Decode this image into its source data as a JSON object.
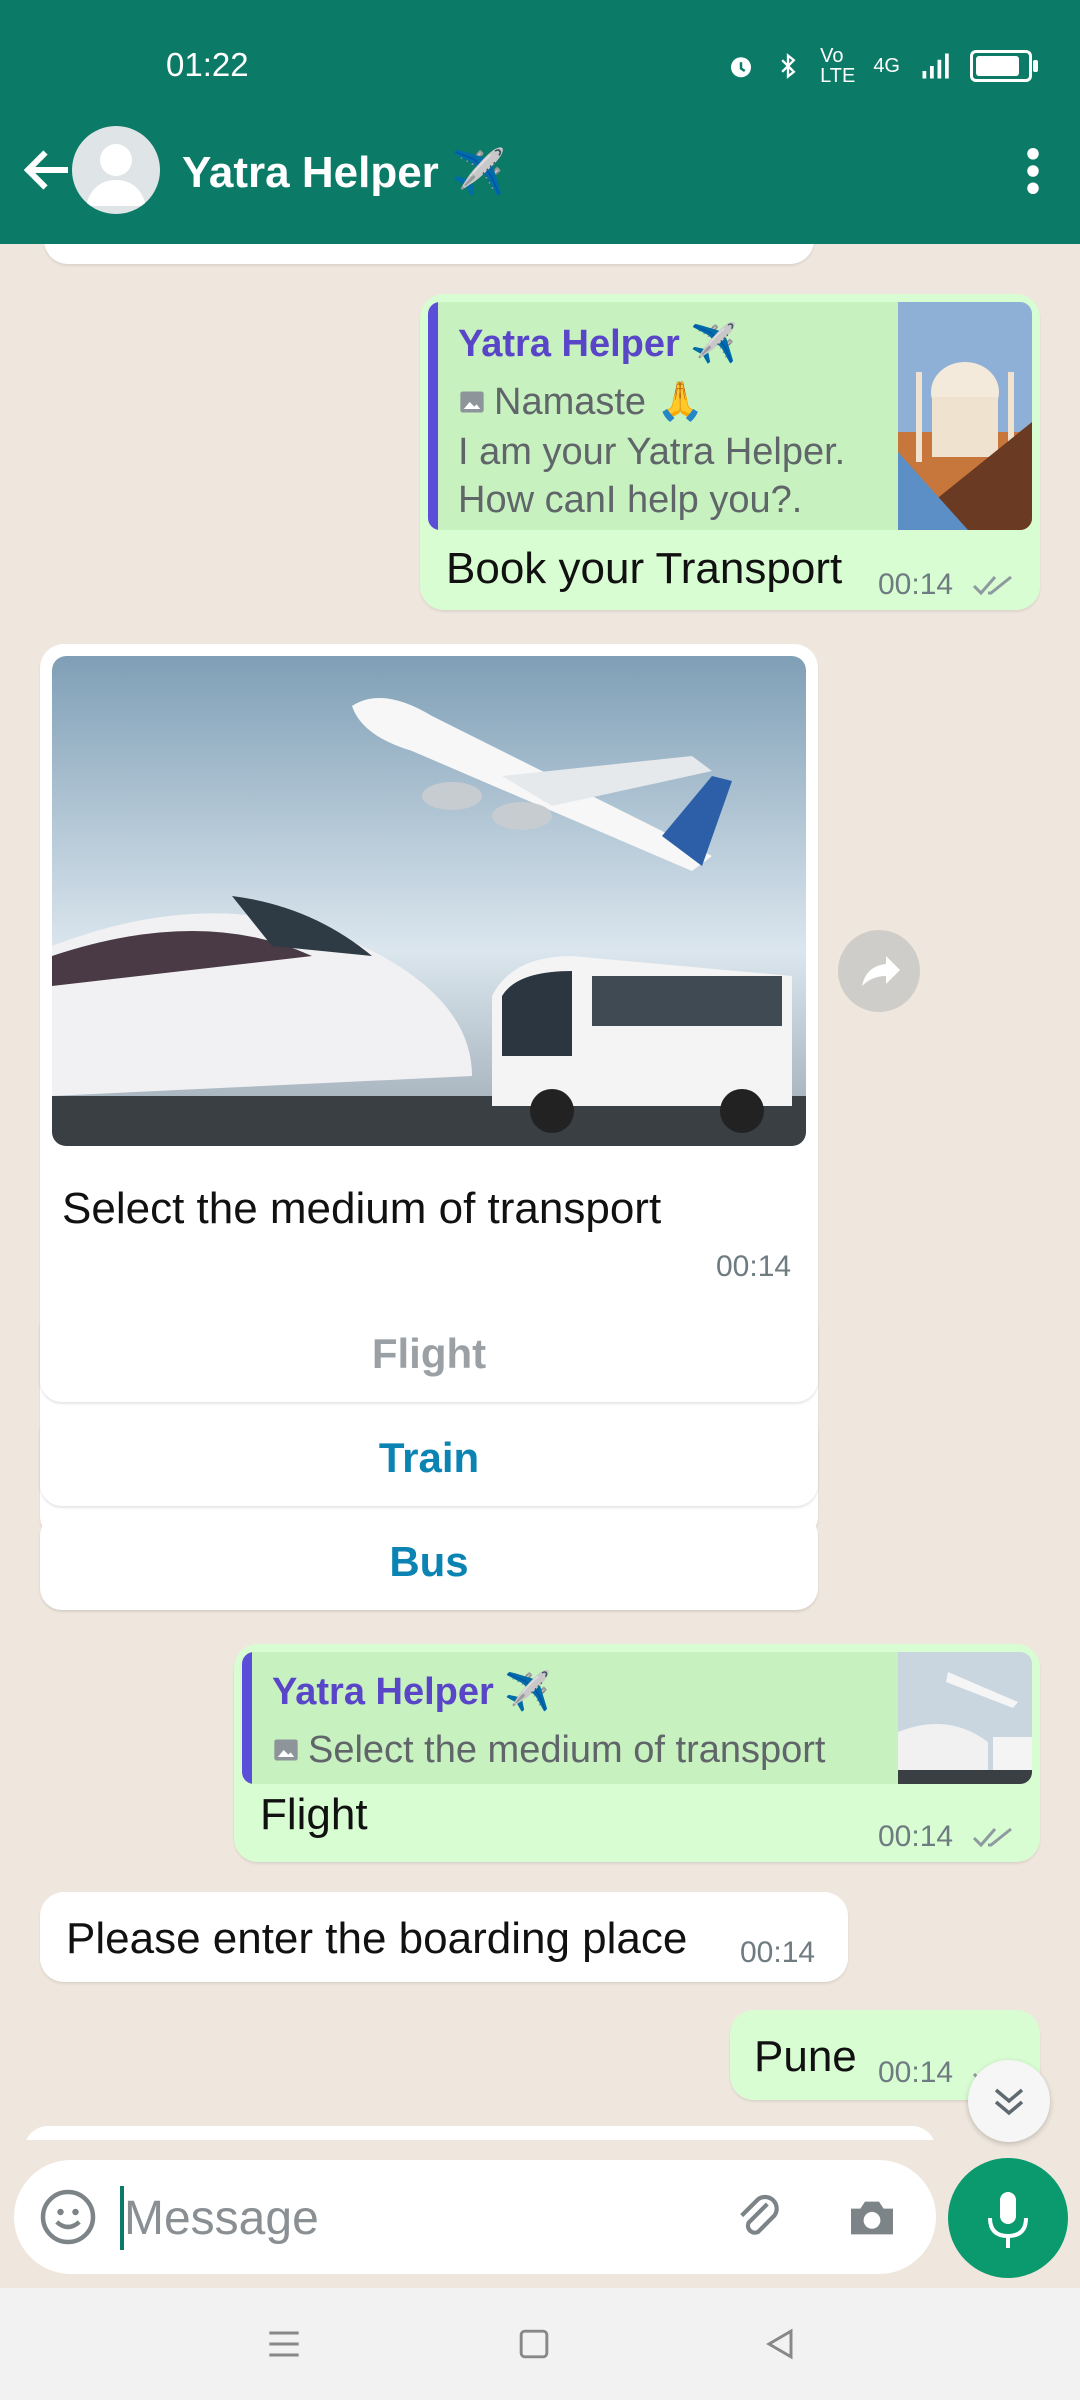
{
  "status": {
    "time": "01:22",
    "icons": [
      "alarm-icon",
      "bluetooth-icon",
      "volte-icon",
      "signal-icon",
      "battery-icon"
    ],
    "network": "4G",
    "battery_percent": 85
  },
  "header": {
    "title": "Yatra Helper ✈️",
    "back_icon": "arrow-left-icon",
    "menu_icon": "more-vert-icon"
  },
  "messages": {
    "m1": {
      "quoted_sender": "Yatra Helper ✈️",
      "quoted_line1": "Namaste 🙏",
      "quoted_line2": "I am your Yatra Helper.",
      "quoted_line3": "How canI help you?.",
      "text": "Book your Transport",
      "time": "00:14"
    },
    "m2": {
      "caption": "Select the medium of transport",
      "time": "00:14"
    },
    "options": [
      "Flight",
      "Train",
      "Bus"
    ],
    "m3": {
      "quoted_sender": "Yatra Helper ✈️",
      "quoted_text": "Select the medium of transport",
      "text": "Flight",
      "time": "00:14"
    },
    "m4": {
      "text": "Please enter the boarding place",
      "time": "00:14"
    },
    "m5": {
      "text": "Pune",
      "time": "00:14"
    }
  },
  "composer": {
    "placeholder": "Message",
    "icons": [
      "emoji-icon",
      "attach-icon",
      "camera-icon",
      "mic-icon"
    ]
  },
  "colors": {
    "header": "#0b7a66",
    "outgoing": "#d9fdd3",
    "incoming": "#ffffff",
    "link": "#0b84b4",
    "accent": "#0a9a6e"
  }
}
